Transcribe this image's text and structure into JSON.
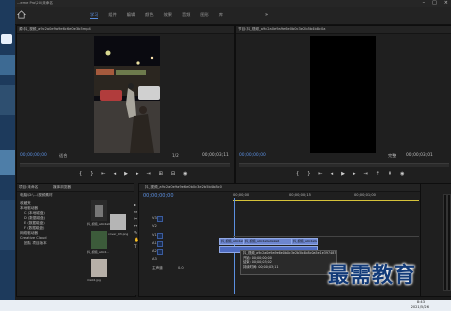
{
  "window": {
    "title": "...eme Pro\\20\\未命名"
  },
  "workspace_tabs": [
    {
      "label": "学习",
      "active": true
    },
    {
      "label": "组件",
      "active": false
    },
    {
      "label": "编辑",
      "active": false
    },
    {
      "label": "颜色",
      "active": false
    },
    {
      "label": "效果",
      "active": false
    },
    {
      "label": "音频",
      "active": false
    },
    {
      "label": "图形",
      "active": false
    },
    {
      "label": "库",
      "active": false
    }
  ],
  "source_monitor": {
    "title": "源:抖_视频_a9c2a0e9a9e6c6e0e3b5mp4",
    "timecode_left": "00;00;00;00",
    "fit": "适合",
    "ratio": "1/2",
    "timecode_right": "00;00;03;11"
  },
  "program_monitor": {
    "title": "节目:抖_视频_a9c2a0e9a9e6e0b0c3e2b5b4b8c0a",
    "timecode_left": "00;00;00;00",
    "fit": "完整",
    "timecode_right": "00;00;03;01"
  },
  "project_panel": {
    "tabs": [
      "项目:未命名",
      "媒体浏览器"
    ],
    "path": "电脑\\D:\\...\\视频素材",
    "tree": [
      "收藏夹",
      "本地驱动器",
      "C (本地磁盘)",
      "D (数据磁盘)",
      "E (数据磁盘)",
      "F (数据磁盘)",
      "网络驱动器",
      "Creative Cloud",
      "团队 项目版本"
    ],
    "thumbs": [
      {
        "label": "抖_视频_a9c2a0e9..."
      },
      {
        "label": "抖_视频_a9c2..."
      },
      {
        "label": "cover_03.png"
      },
      {
        "label": "ms02.jpg"
      }
    ]
  },
  "timeline": {
    "title": "抖_视频_a9c2a0e9a9e6e0b0c3e2b5b4b8c0",
    "timecode": "00;00;00;00",
    "ruler": [
      "00;00;00",
      "00;00;00;15",
      "00;00;01;00"
    ],
    "tracks": [
      "V3",
      "V2",
      "V1",
      "A1",
      "A2",
      "A3",
      "主声道"
    ],
    "master_value": "0.0",
    "clips": [
      {
        "label": "抖_视频_a9c2a0e9"
      },
      {
        "label": "抖_视频_a9c2a0e9a9e6"
      },
      {
        "label": "抖_视频_a9c2a0e9"
      }
    ]
  },
  "tooltip": {
    "lines": [
      "抖_视频_a9c2a0e9a9e6e0b0c3e2b5b4b8c0a5e1e3974877.mp4",
      "开始: 00;00;00;00",
      "结束: 00;00;03;02",
      "持续时间: 00;00;03;11"
    ]
  },
  "taskbar": {
    "time": "8:43",
    "date": "2021/5/26"
  },
  "watermark": "最需教育",
  "colors": {
    "accent": "#5b8fe0",
    "clip": "#6d86cf",
    "watermark": "#123a78"
  }
}
